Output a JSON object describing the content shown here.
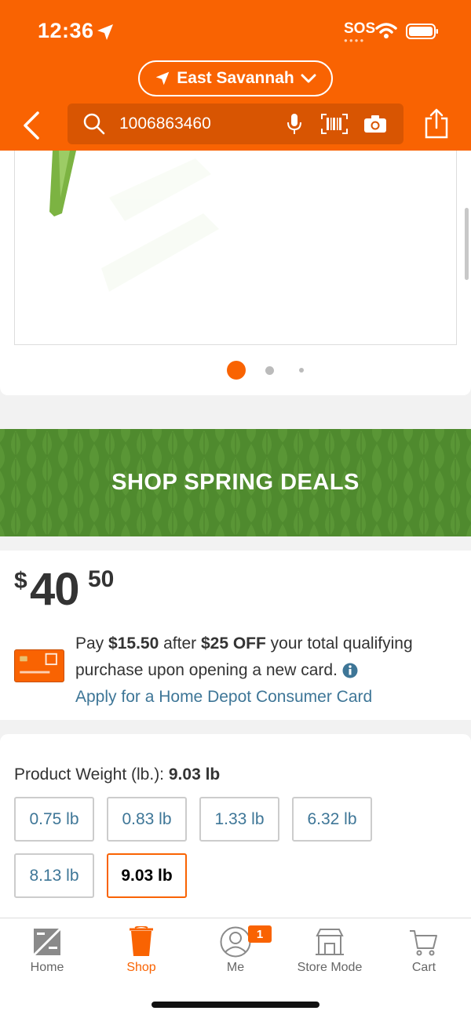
{
  "status_bar": {
    "time": "12:36",
    "sos": "SOS"
  },
  "header": {
    "store_name": "East Savannah",
    "search_value": "1006863460"
  },
  "banner": {
    "text": "SHOP SPRING DEALS",
    "color": "#4f8a2e"
  },
  "price": {
    "dollar_sign": "$",
    "whole": "40",
    "cents": "50"
  },
  "promo": {
    "text_1": "Pay ",
    "amount_after": "$15.50",
    "text_2": " after ",
    "discount": "$25 OFF",
    "text_3": " your total qualifying purchase upon opening a new card.",
    "link": "Apply for a Home Depot Consumer Card"
  },
  "weight": {
    "label": "Product Weight (lb.):",
    "selected": "9.03 lb",
    "options": [
      "0.75 lb",
      "0.83 lb",
      "1.33 lb",
      "6.32 lb",
      "8.13 lb",
      "9.03 lb"
    ],
    "selected_index": 5
  },
  "image_carousel": {
    "total_images": 3,
    "active_index": 0
  },
  "tabbar": {
    "tabs": [
      {
        "label": "Home",
        "icon": "home-depot-logo-icon"
      },
      {
        "label": "Shop",
        "icon": "shop-bucket-icon"
      },
      {
        "label": "Me",
        "icon": "user-icon"
      },
      {
        "label": "Store Mode",
        "icon": "store-icon"
      },
      {
        "label": "Cart",
        "icon": "cart-icon"
      }
    ],
    "active_index": 1,
    "me_badge": "1"
  },
  "colors": {
    "brand": "#f96302",
    "link": "#3e7697"
  }
}
